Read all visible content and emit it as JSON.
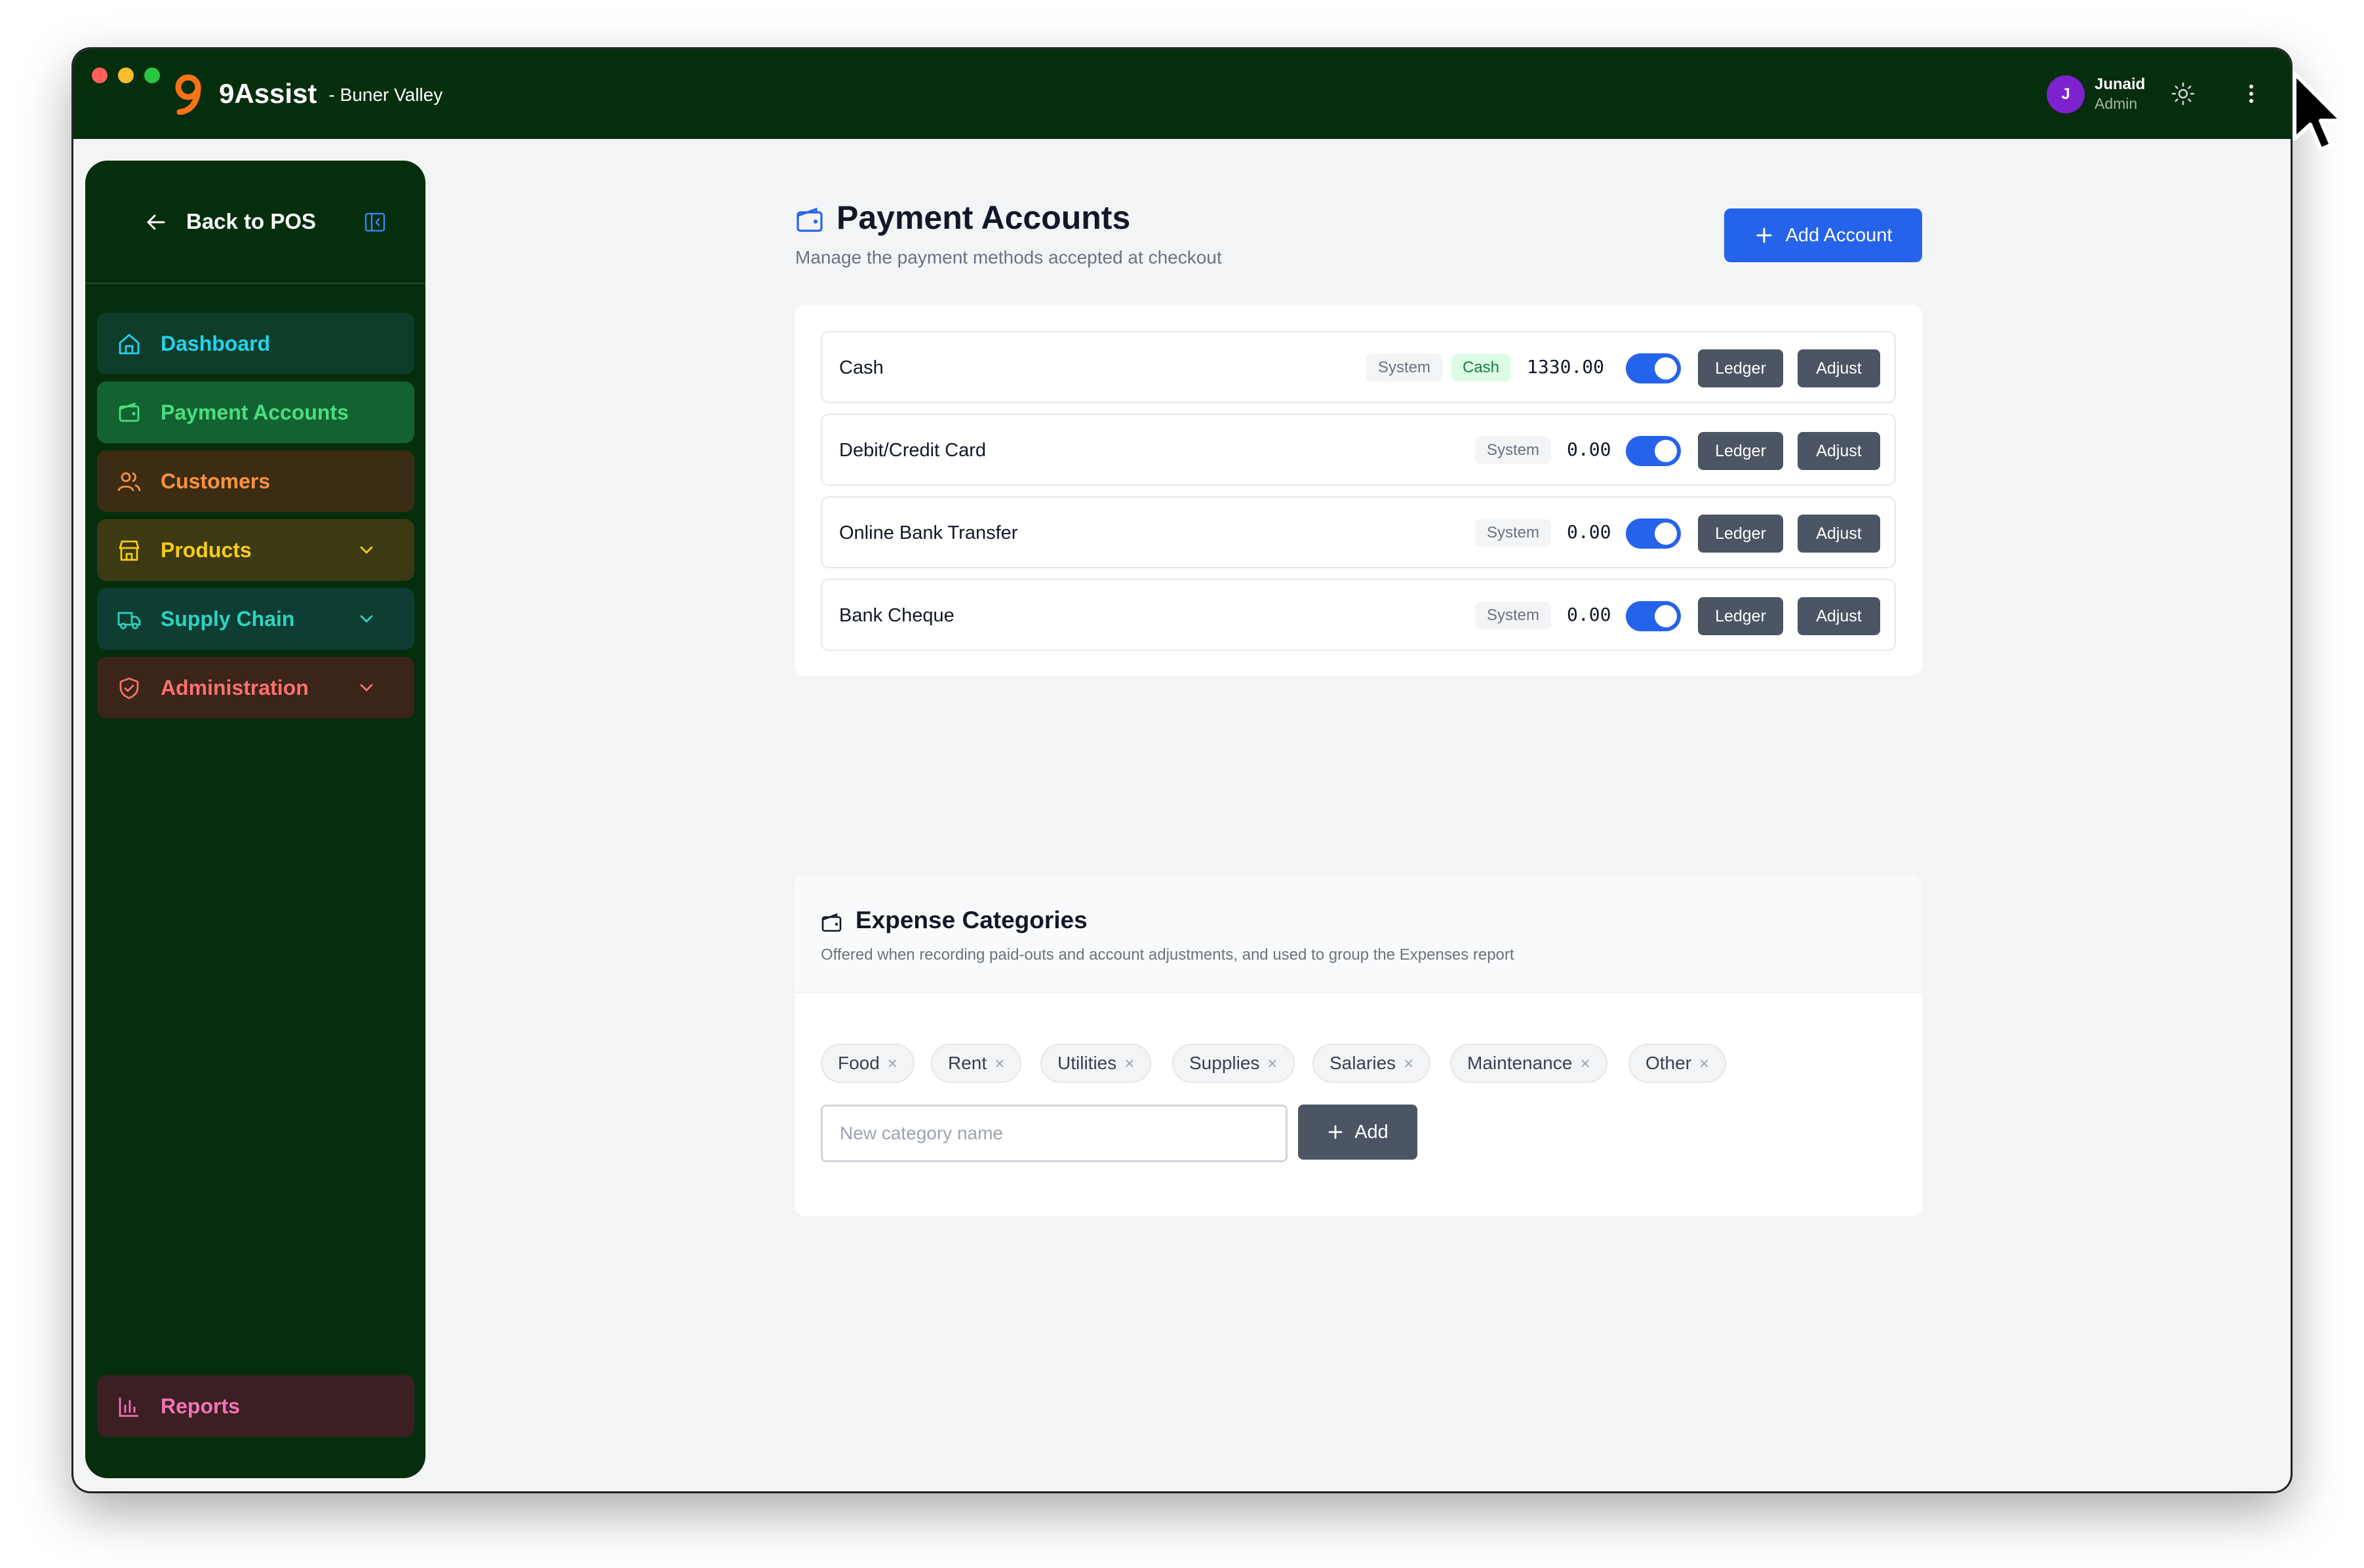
{
  "app": {
    "name": "9Assist",
    "location": "- Buner Valley"
  },
  "user": {
    "initial": "J",
    "name": "Junaid",
    "role": "Admin"
  },
  "sidebar": {
    "back_label": "Back to POS",
    "items": [
      {
        "label": "Dashboard",
        "color": "#22d3ee"
      },
      {
        "label": "Payment Accounts",
        "color": "#4ade80"
      },
      {
        "label": "Customers",
        "color": "#fb923c"
      },
      {
        "label": "Products",
        "color": "#facc15"
      },
      {
        "label": "Supply Chain",
        "color": "#2dd4bf"
      },
      {
        "label": "Administration",
        "color": "#f87171"
      }
    ],
    "reports_label": "Reports",
    "reports_color": "#f472b6"
  },
  "main": {
    "title": "Payment Accounts",
    "subtitle": "Manage the payment methods accepted at checkout",
    "add_account_label": "Add Account",
    "accounts": [
      {
        "name": "Cash",
        "system_label": "System",
        "type_label": "Cash",
        "amount": "1330.00",
        "enabled": true,
        "ledger_label": "Ledger",
        "adjust_label": "Adjust"
      },
      {
        "name": "Debit/Credit Card",
        "system_label": "System",
        "amount": "0.00",
        "enabled": true,
        "ledger_label": "Ledger",
        "adjust_label": "Adjust"
      },
      {
        "name": "Online Bank Transfer",
        "system_label": "System",
        "amount": "0.00",
        "enabled": true,
        "ledger_label": "Ledger",
        "adjust_label": "Adjust"
      },
      {
        "name": "Bank Cheque",
        "system_label": "System",
        "amount": "0.00",
        "enabled": true,
        "ledger_label": "Ledger",
        "adjust_label": "Adjust"
      }
    ]
  },
  "expenses": {
    "title": "Expense Categories",
    "subtitle": "Offered when recording paid-outs and account adjustments, and used to group the Expenses report",
    "categories": [
      "Food",
      "Rent",
      "Utilities",
      "Supplies",
      "Salaries",
      "Maintenance",
      "Other"
    ],
    "remove_glyph": "×",
    "input_placeholder": "New category name",
    "add_label": "Add"
  },
  "colors": {
    "titlebar": "#052e0d",
    "primary": "#2563eb",
    "dark_button": "#4b5563"
  }
}
